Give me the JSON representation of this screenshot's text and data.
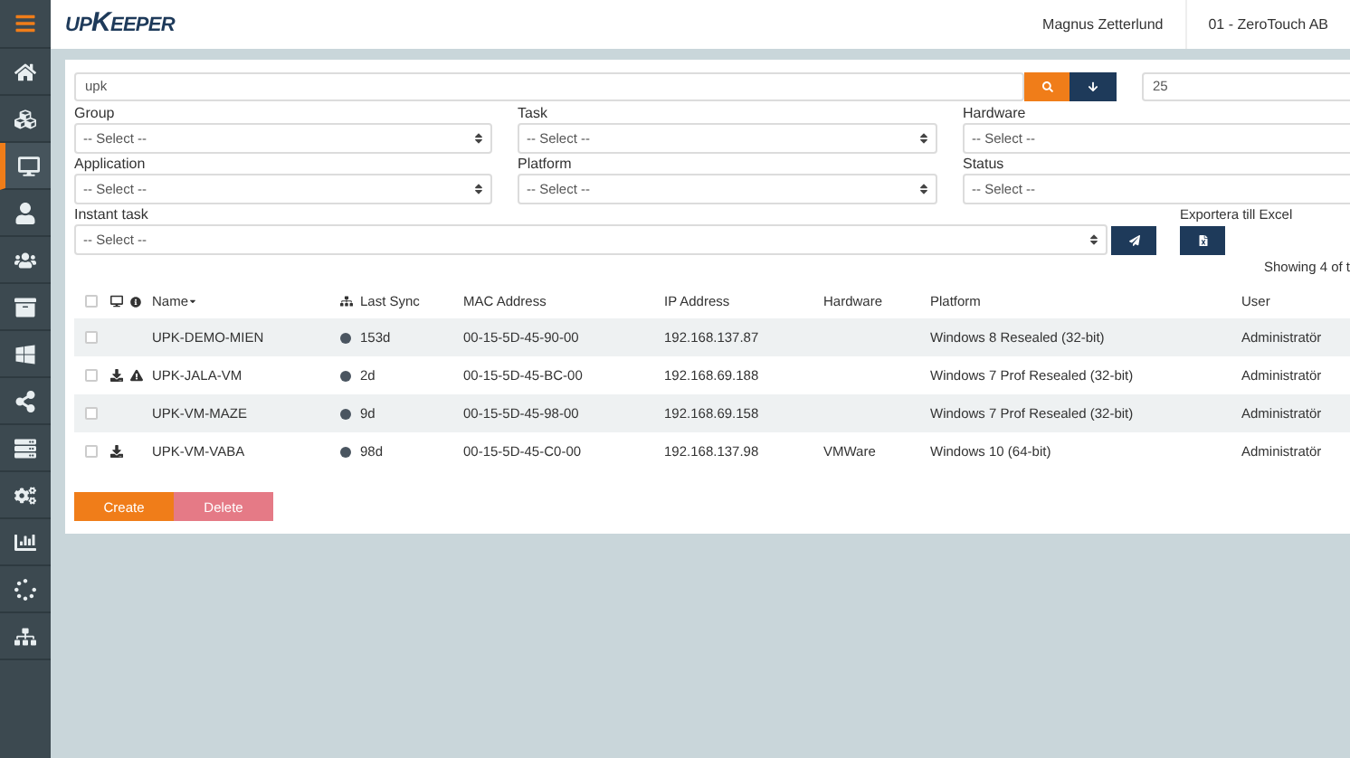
{
  "header": {
    "logo": "upKeeper",
    "user": "Magnus Zetterlund",
    "company": "01 - ZeroTouch AB"
  },
  "sidebar": {
    "items": [
      {
        "selected": false
      },
      {
        "selected": false
      },
      {
        "selected": true
      },
      {
        "selected": false
      },
      {
        "selected": false
      },
      {
        "selected": false
      },
      {
        "selected": false
      },
      {
        "selected": false
      },
      {
        "selected": false
      },
      {
        "selected": false
      },
      {
        "selected": false
      },
      {
        "selected": false
      },
      {
        "selected": false
      }
    ]
  },
  "search": {
    "value": "upk"
  },
  "page_size": {
    "value": "25"
  },
  "filters": [
    {
      "label": "Group",
      "value": "-- Select --"
    },
    {
      "label": "Task",
      "value": "-- Select --"
    },
    {
      "label": "Hardware",
      "value": "-- Select --"
    },
    {
      "label": "Application",
      "value": "-- Select --"
    },
    {
      "label": "Platform",
      "value": "-- Select --"
    },
    {
      "label": "Status",
      "value": "-- Select --"
    }
  ],
  "instant_task": {
    "label": "Instant task",
    "value": "-- Select --"
  },
  "export": {
    "label": "Exportera till Excel"
  },
  "showing": "Showing 4 of t",
  "table": {
    "all_checked": false,
    "columns": [
      "Name",
      "Last Sync",
      "MAC Address",
      "IP Address",
      "Hardware",
      "Platform",
      "User"
    ],
    "rows": [
      {
        "checked": false,
        "download": false,
        "warning": false,
        "name": "UPK-DEMO-MIEN",
        "last_sync": "153d",
        "mac": "00-15-5D-45-90-00",
        "ip": "192.168.137.87",
        "hardware": "",
        "platform": "Windows 8 Resealed (32-bit)",
        "user": "Administratör"
      },
      {
        "checked": false,
        "download": true,
        "warning": true,
        "name": "UPK-JALA-VM",
        "last_sync": "2d",
        "mac": "00-15-5D-45-BC-00",
        "ip": "192.168.69.188",
        "hardware": "",
        "platform": "Windows 7 Prof Resealed (32-bit)",
        "user": "Administratör"
      },
      {
        "checked": false,
        "download": false,
        "warning": false,
        "name": "UPK-VM-MAZE",
        "last_sync": "9d",
        "mac": "00-15-5D-45-98-00",
        "ip": "192.168.69.158",
        "hardware": "",
        "platform": "Windows 7 Prof Resealed (32-bit)",
        "user": "Administratör"
      },
      {
        "checked": false,
        "download": true,
        "warning": false,
        "name": "UPK-VM-VABA",
        "last_sync": "98d",
        "mac": "00-15-5D-45-C0-00",
        "ip": "192.168.137.98",
        "hardware": "VMWare",
        "platform": "Windows 10 (64-bit)",
        "user": "Administratör"
      }
    ]
  },
  "buttons": {
    "create": "Create",
    "delete": "Delete"
  }
}
